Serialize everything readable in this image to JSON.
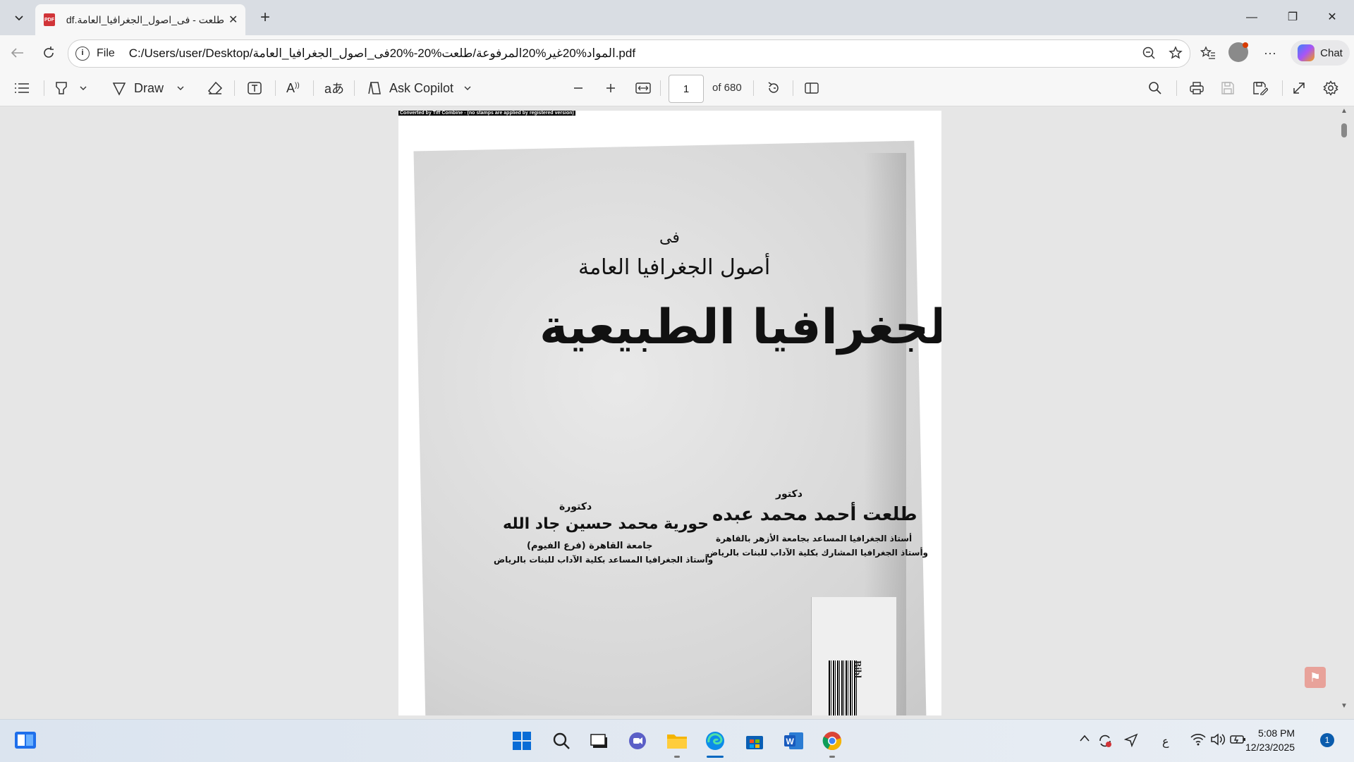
{
  "browser": {
    "tab_title": "طلعت - فى_اصول_الجغرافيا_العامة.pdf",
    "tab_icon_text": "PDF",
    "url_protocol": "File",
    "url": "C:/Users/user/Desktop/المواد%20غير%20المرفوعة/طلعت%20-%20فى_اصول_الجغرافيا_العامة.pdf",
    "chat_label": "Chat"
  },
  "toolbar": {
    "draw_label": "Draw",
    "copilot_label": "Ask Copilot",
    "page_number": "1",
    "page_total": "of 680"
  },
  "document": {
    "converted_note": "Converted by Tiff Combine - (no stamps are applied by registered version)",
    "line_fi": "فى",
    "subtitle": "أصول الجغرافيا العامة",
    "main_title": "الجغرافيا الطبيعية",
    "author1": {
      "title": "دكتور",
      "name": "طلعت أحمد محمد عبده",
      "line1": "أستاذ الجغرافيا المساعد بجامعة الأزهر بالقاهرة",
      "line2": "وأستاذ الجغرافيا المشارك بكلية الآداب للبنات بالرياض"
    },
    "author2": {
      "title": "دكتورة",
      "name": "حورية محمد حسين جاد الله",
      "line1": "جامعة القاهرة (فرع الفيوم)",
      "line2": "وأستاذ الجغرافيا المساعد بكلية الآداب للبنات بالرياض"
    },
    "stamp_text": "Bibl"
  },
  "taskbar": {
    "lang_indicator": "ع",
    "time": "5:08 PM",
    "date": "12/23/2025",
    "notification_count": "1"
  }
}
